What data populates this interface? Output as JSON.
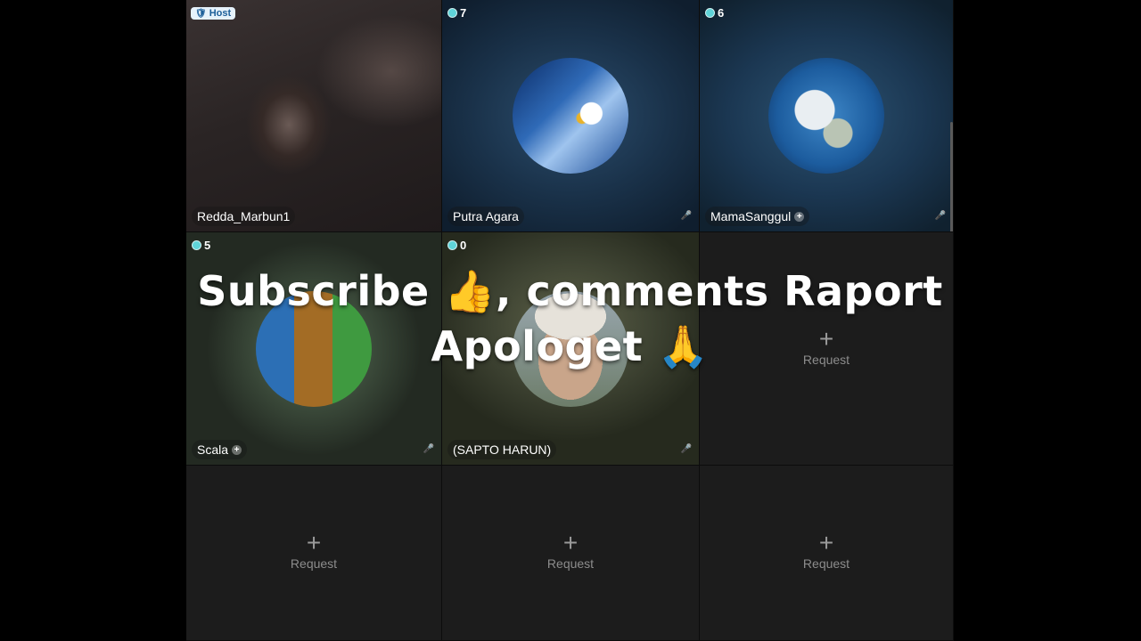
{
  "tiles": [
    {
      "name": "Redda_Marbun1",
      "badge": "Host",
      "host_icon": "🛡"
    },
    {
      "name": "Putra Agara",
      "count": "7"
    },
    {
      "name": "MamaSanggul",
      "count": "6",
      "plus": "+"
    },
    {
      "name": "Scala",
      "count": "5",
      "plus": "+"
    },
    {
      "name": "(SAPTO HARUN)",
      "count": "0"
    }
  ],
  "request": {
    "plus": "+",
    "label": "Request"
  },
  "mic_icon": "🎤",
  "overlay": {
    "line1": "Subscribe 👍, comments Raport",
    "line2": "Apologet 🙏"
  },
  "colors": {
    "accent": "#5fd4d9",
    "host_badge_bg": "#e6f2fb"
  }
}
